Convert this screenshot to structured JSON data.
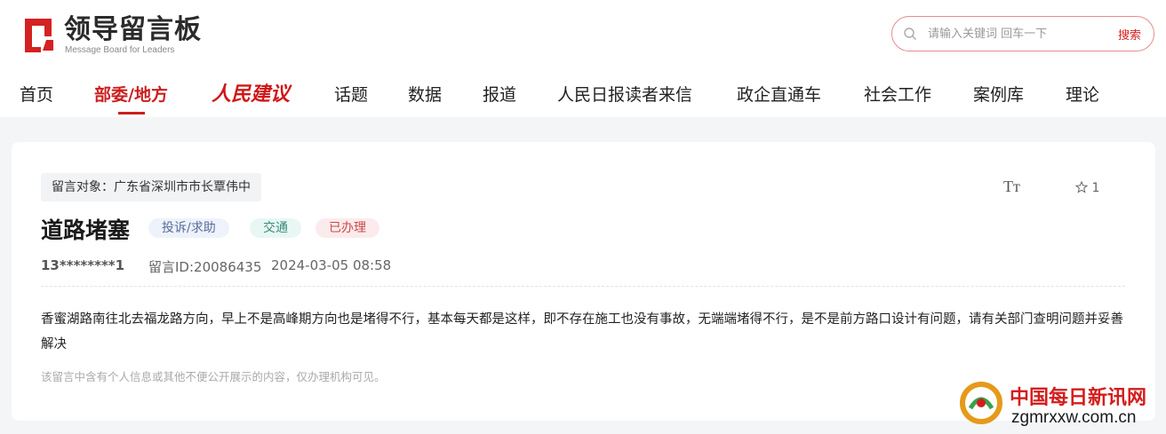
{
  "header": {
    "logo_text": "领导留言板",
    "logo_sub": "Message Board for Leaders",
    "search": {
      "placeholder": "请输入关键词 回车一下",
      "button": "搜索"
    }
  },
  "nav": [
    {
      "label": "首页"
    },
    {
      "label": "部委/地方",
      "active": true
    },
    {
      "label": "人民建议"
    },
    {
      "label": "话题"
    },
    {
      "label": "数据"
    },
    {
      "label": "报道"
    },
    {
      "label": "人民日报读者来信"
    },
    {
      "label": "政企直通车"
    },
    {
      "label": "社会工作"
    },
    {
      "label": "案例库"
    },
    {
      "label": "理论"
    }
  ],
  "message": {
    "target": "留言对象：广东省深圳市市长覃伟中",
    "font_toggle": "Tт",
    "favorite_count": "1",
    "title": "道路堵塞",
    "tags": [
      "投诉/求助",
      "交通",
      "已办理"
    ],
    "user": "13********1",
    "message_id": "留言ID:20086435",
    "datetime": "2024-03-05 08:58",
    "content": "香蜜湖路南往北去福龙路方向，早上不是高峰期方向也是堵得不行，基本每天都是这样，即不存在施工也没有事故，无端端堵得不行，是不是前方路口设计有问题，请有关部门查明问题并妥善解决",
    "notice": "该留言中含有个人信息或其他不便公开展示的内容，仅办理机构可见。"
  },
  "watermark": {
    "cn": "中国每日新讯网",
    "en": "zgmrxxw.com.cn"
  },
  "colors": {
    "accent": "#cc1f1f",
    "background": "#f4f5f7"
  }
}
